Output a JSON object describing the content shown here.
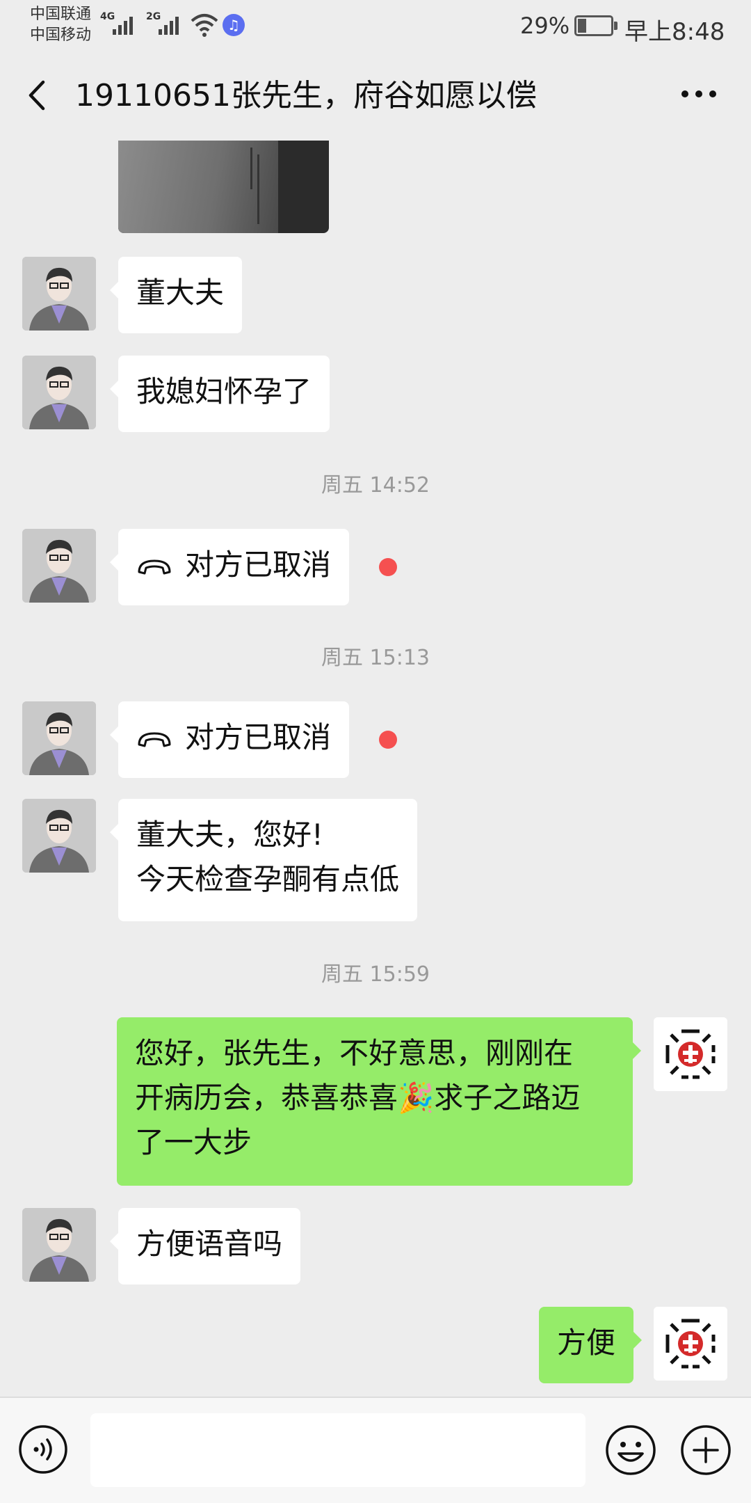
{
  "status_bar": {
    "carrier_1": "中国联通",
    "carrier_2": "中国移动",
    "net_1": "4G",
    "net_2": "2G",
    "battery": "29%",
    "time": "早上8:48"
  },
  "header": {
    "title": "19110651张先生，府谷如愿以偿",
    "back_icon": "chevron-left-icon",
    "more_icon": "ellipsis-icon"
  },
  "messages": {
    "m1": "董大夫",
    "m2": "我媳妇怀孕了",
    "t1": "周五 14:52",
    "m3": "对方已取消",
    "t2": "周五 15:13",
    "m4": "对方已取消",
    "m5_line1": "董大夫，您好!",
    "m5_line2": "今天检查孕酮有点低",
    "t3": "周五 15:59",
    "m6_line1": "您好，张先生，不好意思，刚刚在",
    "m6_line2": "开病历会，恭喜恭喜🎉求子之路迈",
    "m6_line3": "了一大步",
    "m7": "方便语音吗",
    "m8": "方便"
  },
  "input_bar": {
    "placeholder": "",
    "voice_icon": "voice-icon",
    "emoji_icon": "emoji-icon",
    "plus_icon": "plus-icon"
  },
  "colors": {
    "background": "#ededed",
    "bubble_self": "#95ec69",
    "bubble_other": "#ffffff",
    "unread": "#f55050"
  }
}
